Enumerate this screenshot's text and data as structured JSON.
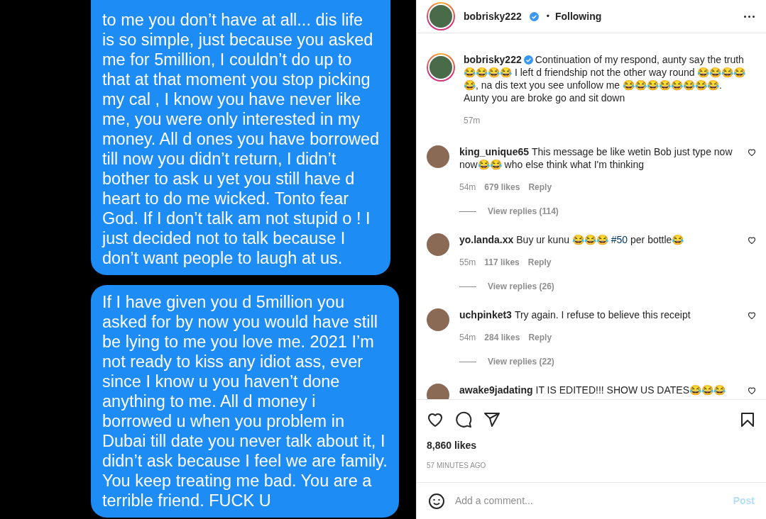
{
  "photo": {
    "messages": [
      {
        "text": "to me you don’t have at all... dis life\nis so simple, just because you asked\nme for 5million, I couldn’t do up to\nthat at that moment you stop picking\nmy cal , I know you have never like\nme, you were only interested in my\nmoney. All d ones you have borrowed\ntill now you didn’t return, I didn’t\nbother to ask u yet you still have d\nheart to do me wicked. Tonto fear\nGod. If I don’t talk am not stupid o ! I\njust decided not to talk because I\ndon’t want people to laugh at us."
      },
      {
        "text": "If I have given you d 5million you\nasked for by now you would have still\nbe lying to me you love me. 2021 I’m\nnot ready to kiss any idiot ass, ever\nsince I know u you haven’t done\nanything to me. All d money i\nborrowed u when you problem in\nDubai till date you never talk about it, I\ndidn’t ask because I feel we are family.\nYou keep treating me bad. You are a\nterrible friend. FUCK U"
      }
    ]
  },
  "header": {
    "username": "bobrisky222",
    "verified": true,
    "follow_label": "Following",
    "separator": "•"
  },
  "caption": {
    "username": "bobrisky222",
    "verified": true,
    "text": "Continuation of my respond, aunty say the truth 😂😂😂😂 I left d friendship not the other way round 😂😂😂😂😂, na dis text you see unfollow me 😂😂😂😂😂😂😂😂. Aunty you are broke go and sit down",
    "time": "57m"
  },
  "comments": [
    {
      "username": "king_unique65",
      "text": "This message be like wetin Bob just type now now😂😂 who else think what I'm thinking",
      "time": "54m",
      "likes": "679 likes",
      "reply": "Reply",
      "view_replies": "View replies (114)"
    },
    {
      "username": "yo.landa.xx",
      "text": "Buy ur kunu 😂😂😂 **#50** per bottle😂",
      "time": "55m",
      "likes": "117 likes",
      "reply": "Reply",
      "view_replies": "View replies (26)"
    },
    {
      "username": "uchpinket3",
      "text": "Try again. I refuse to believe this receipt",
      "time": "54m",
      "likes": "284 likes",
      "reply": "Reply",
      "view_replies": "View replies (22)"
    },
    {
      "username": "awake9jadating",
      "text": "IT IS EDITED!!! SHOW US DATES😂😂😂"
    }
  ],
  "likes": "8,860 likes",
  "posted": "57 MINUTES AGO",
  "comment_box": {
    "placeholder": "Add a comment...",
    "post_label": "Post"
  }
}
